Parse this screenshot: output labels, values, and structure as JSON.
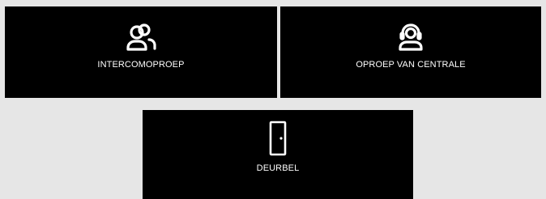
{
  "background_color": "#e6e6e6",
  "tile_color": "#000000",
  "text_color": "#ffffff",
  "tiles": [
    {
      "icon": "two-users-icon",
      "label": "INTERCOMOPROEP"
    },
    {
      "icon": "headset-user-icon",
      "label": "OPROEP VAN CENTRALE"
    },
    {
      "icon": "door-icon",
      "label": "DEURBEL"
    }
  ]
}
